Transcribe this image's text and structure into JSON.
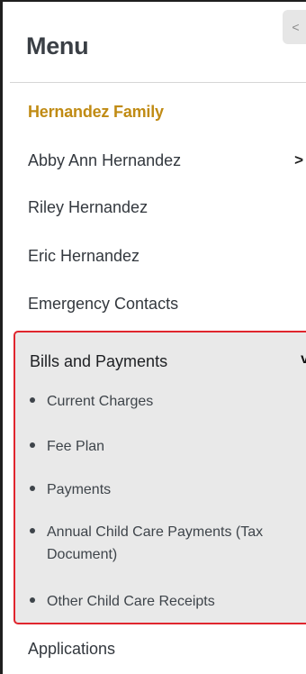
{
  "collapse_glyph": "<",
  "menu": {
    "title": "Menu",
    "family": "Hernandez Family",
    "items": [
      {
        "label": "Abby Ann Hernandez",
        "has_chevron": true,
        "chevron": ">"
      },
      {
        "label": "Riley Hernandez"
      },
      {
        "label": "Eric Hernandez"
      },
      {
        "label": "Emergency Contacts"
      }
    ],
    "bills": {
      "label": "Bills and Payments",
      "expanded": true,
      "chevron": "v",
      "subitems": [
        "Current Charges",
        "Fee Plan",
        "Payments",
        "Annual Child Care Payments (Tax Document)",
        "Other Child Care Receipts"
      ]
    },
    "applications": "Applications"
  },
  "colors": {
    "family": "#c08b14",
    "highlight_border": "#e0262e",
    "section_bg": "#e9e9e9"
  }
}
